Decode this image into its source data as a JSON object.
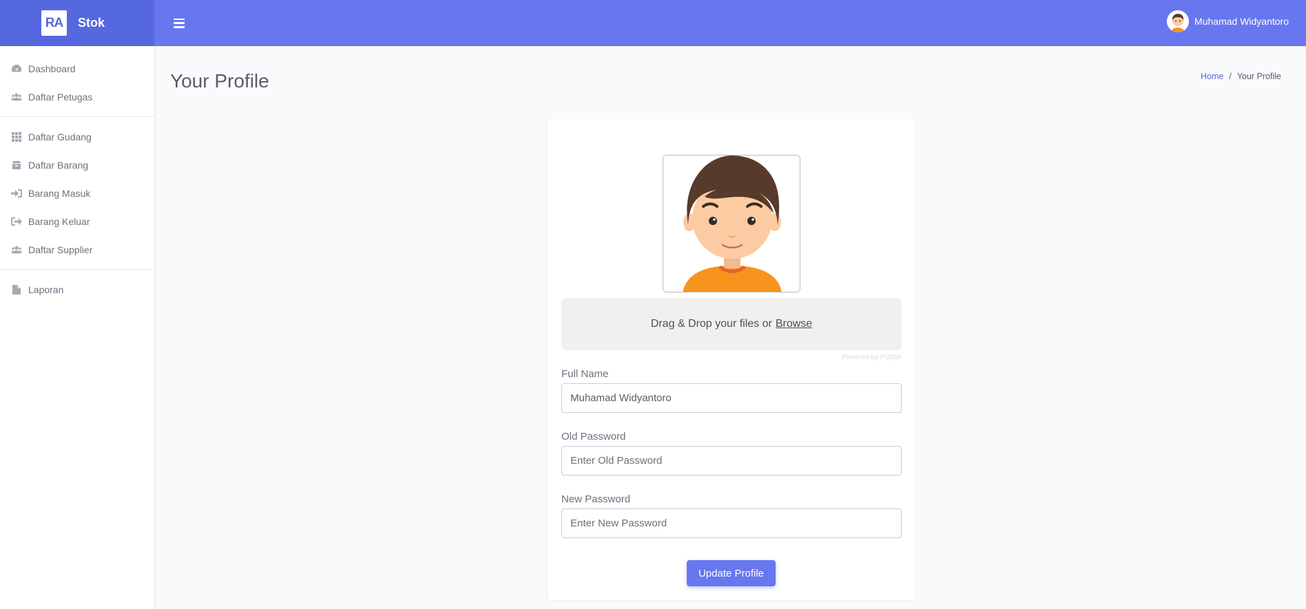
{
  "brand": {
    "logo_text": "RA",
    "name": "Stok",
    "color": "#5568e0"
  },
  "topbar": {
    "color": "#6777ef",
    "user_name": "Muhamad Widyantoro"
  },
  "sidebar": {
    "items": [
      {
        "label": "Dashboard",
        "icon": "tachometer-icon"
      },
      {
        "label": "Daftar Petugas",
        "icon": "users-icon"
      },
      {
        "label": "Daftar Gudang",
        "icon": "grid-icon"
      },
      {
        "label": "Daftar Barang",
        "icon": "box-icon"
      },
      {
        "label": "Barang Masuk",
        "icon": "sign-in-icon"
      },
      {
        "label": "Barang Keluar",
        "icon": "sign-out-icon"
      },
      {
        "label": "Daftar Supplier",
        "icon": "users-icon"
      },
      {
        "label": "Laporan",
        "icon": "file-icon"
      }
    ]
  },
  "page": {
    "title": "Your Profile"
  },
  "breadcrumb": {
    "home": "Home",
    "separator": "/",
    "current": "Your Profile"
  },
  "form": {
    "dropzone": {
      "text": "Drag & Drop your files or",
      "browse": "Browse",
      "powered_by": "Powered by PQINA"
    },
    "full_name": {
      "label": "Full Name",
      "value": "Muhamad Widyantoro"
    },
    "old_password": {
      "label": "Old Password",
      "placeholder": "Enter Old Password"
    },
    "new_password": {
      "label": "New Password",
      "placeholder": "Enter New Password"
    },
    "submit_label": "Update Profile"
  }
}
